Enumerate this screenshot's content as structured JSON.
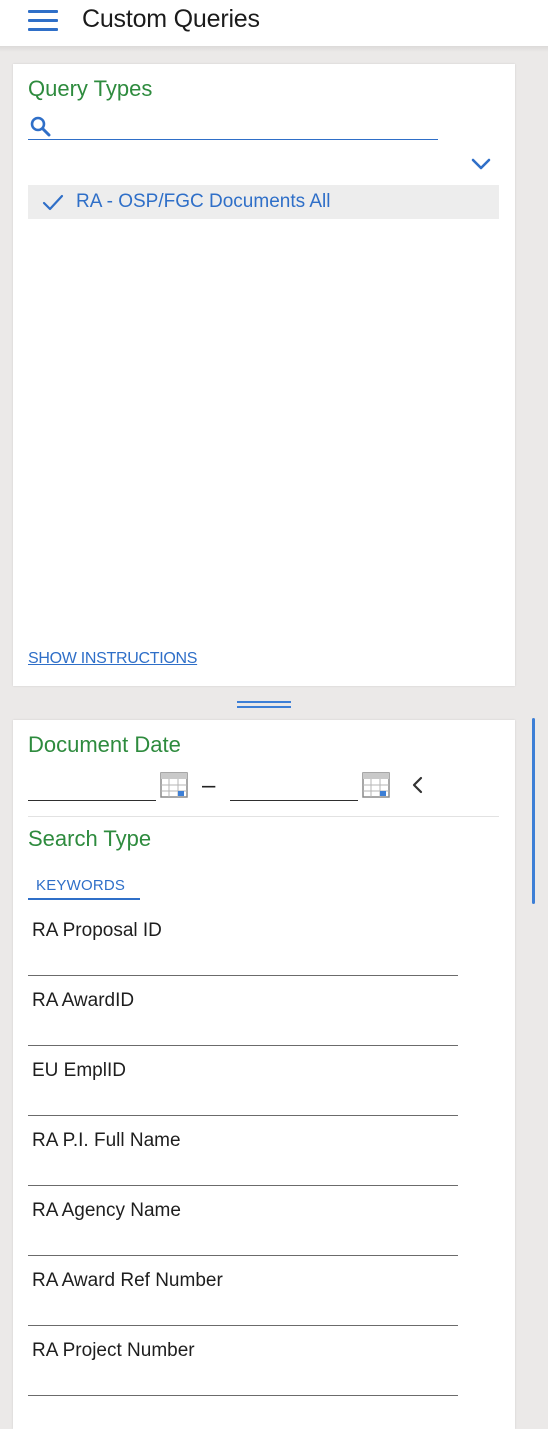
{
  "header": {
    "title": "Custom Queries",
    "menu_icon": "hamburger-menu-icon"
  },
  "query_types": {
    "title": "Query Types",
    "search": {
      "placeholder": "",
      "value": "",
      "icon": "search-icon"
    },
    "expand_icon": "chevron-down-icon",
    "items": [
      {
        "label": "RA - OSP/FGC Documents All",
        "selected": true,
        "icon": "checkmark-icon"
      }
    ],
    "show_instructions_label": "SHOW INSTRUCTIONS"
  },
  "document_date": {
    "title": "Document Date",
    "from_value": "",
    "to_value": "",
    "separator": "–",
    "calendar_icon": "calendar-icon",
    "collapse_icon": "chevron-left-icon"
  },
  "search_type": {
    "title": "Search Type",
    "tabs": [
      {
        "label": "KEYWORDS",
        "active": true
      }
    ],
    "fields": [
      {
        "label": "RA Proposal ID",
        "value": ""
      },
      {
        "label": "RA AwardID",
        "value": ""
      },
      {
        "label": "EU EmplID",
        "value": ""
      },
      {
        "label": "RA P.I. Full Name",
        "value": ""
      },
      {
        "label": "RA Agency Name",
        "value": ""
      },
      {
        "label": "RA Award Ref Number",
        "value": ""
      },
      {
        "label": "RA Project Number",
        "value": ""
      }
    ]
  },
  "colors": {
    "accent_blue": "#2f6fc8",
    "section_green": "#2e8b3e",
    "background": "#ebe9e8",
    "selected_row": "#ededed"
  }
}
